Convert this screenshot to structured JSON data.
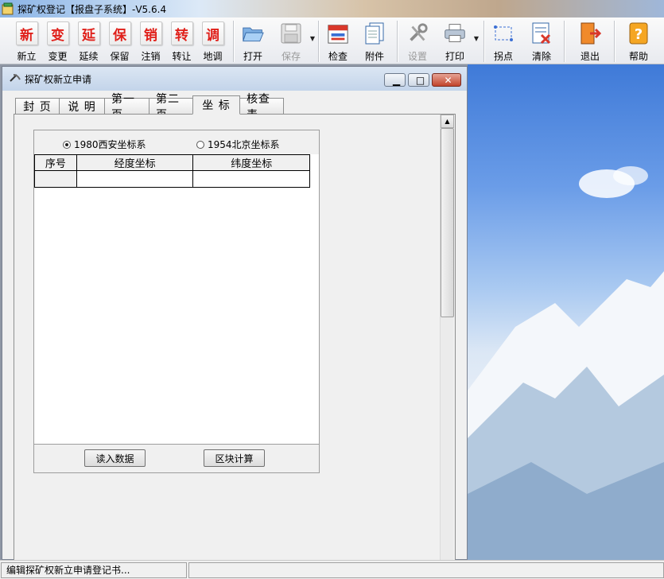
{
  "app": {
    "title": "探矿权登记【报盘子系统】-V5.6.4"
  },
  "toolbar": {
    "items": [
      {
        "label": "新立",
        "icon_char": "新"
      },
      {
        "label": "变更",
        "icon_char": "变"
      },
      {
        "label": "延续",
        "icon_char": "延"
      },
      {
        "label": "保留",
        "icon_char": "保"
      },
      {
        "label": "注销",
        "icon_char": "销"
      },
      {
        "label": "转让",
        "icon_char": "转"
      },
      {
        "label": "地调",
        "icon_char": "调"
      }
    ],
    "open_label": "打开",
    "save_label": "保存",
    "check_label": "检查",
    "attach_label": "附件",
    "settings_label": "设置",
    "print_label": "打印",
    "inflection_label": "拐点",
    "clear_label": "清除",
    "exit_label": "退出",
    "help_label": "帮助"
  },
  "child_window": {
    "title": "探矿权新立申请",
    "tabs": [
      "封 页",
      "说 明",
      "第一页",
      "第二页",
      "坐 标",
      "核查表"
    ],
    "active_tab": "坐 标"
  },
  "coordinates": {
    "radio_1980": "1980西安坐标系",
    "radio_1954": "1954北京坐标系",
    "selected_system": "1980西安坐标系",
    "columns": [
      "序号",
      "经度坐标",
      "纬度坐标"
    ],
    "rows": [
      [
        "",
        "",
        ""
      ]
    ],
    "read_data_button": "读入数据",
    "block_calc_button": "区块计算"
  },
  "status": {
    "message": "编辑探矿权新立申请登记书..."
  },
  "colors": {
    "accent_red": "#e0201a",
    "title_gradient_start": "#8ab4e6",
    "sky_blue": "#3f7ad8"
  }
}
